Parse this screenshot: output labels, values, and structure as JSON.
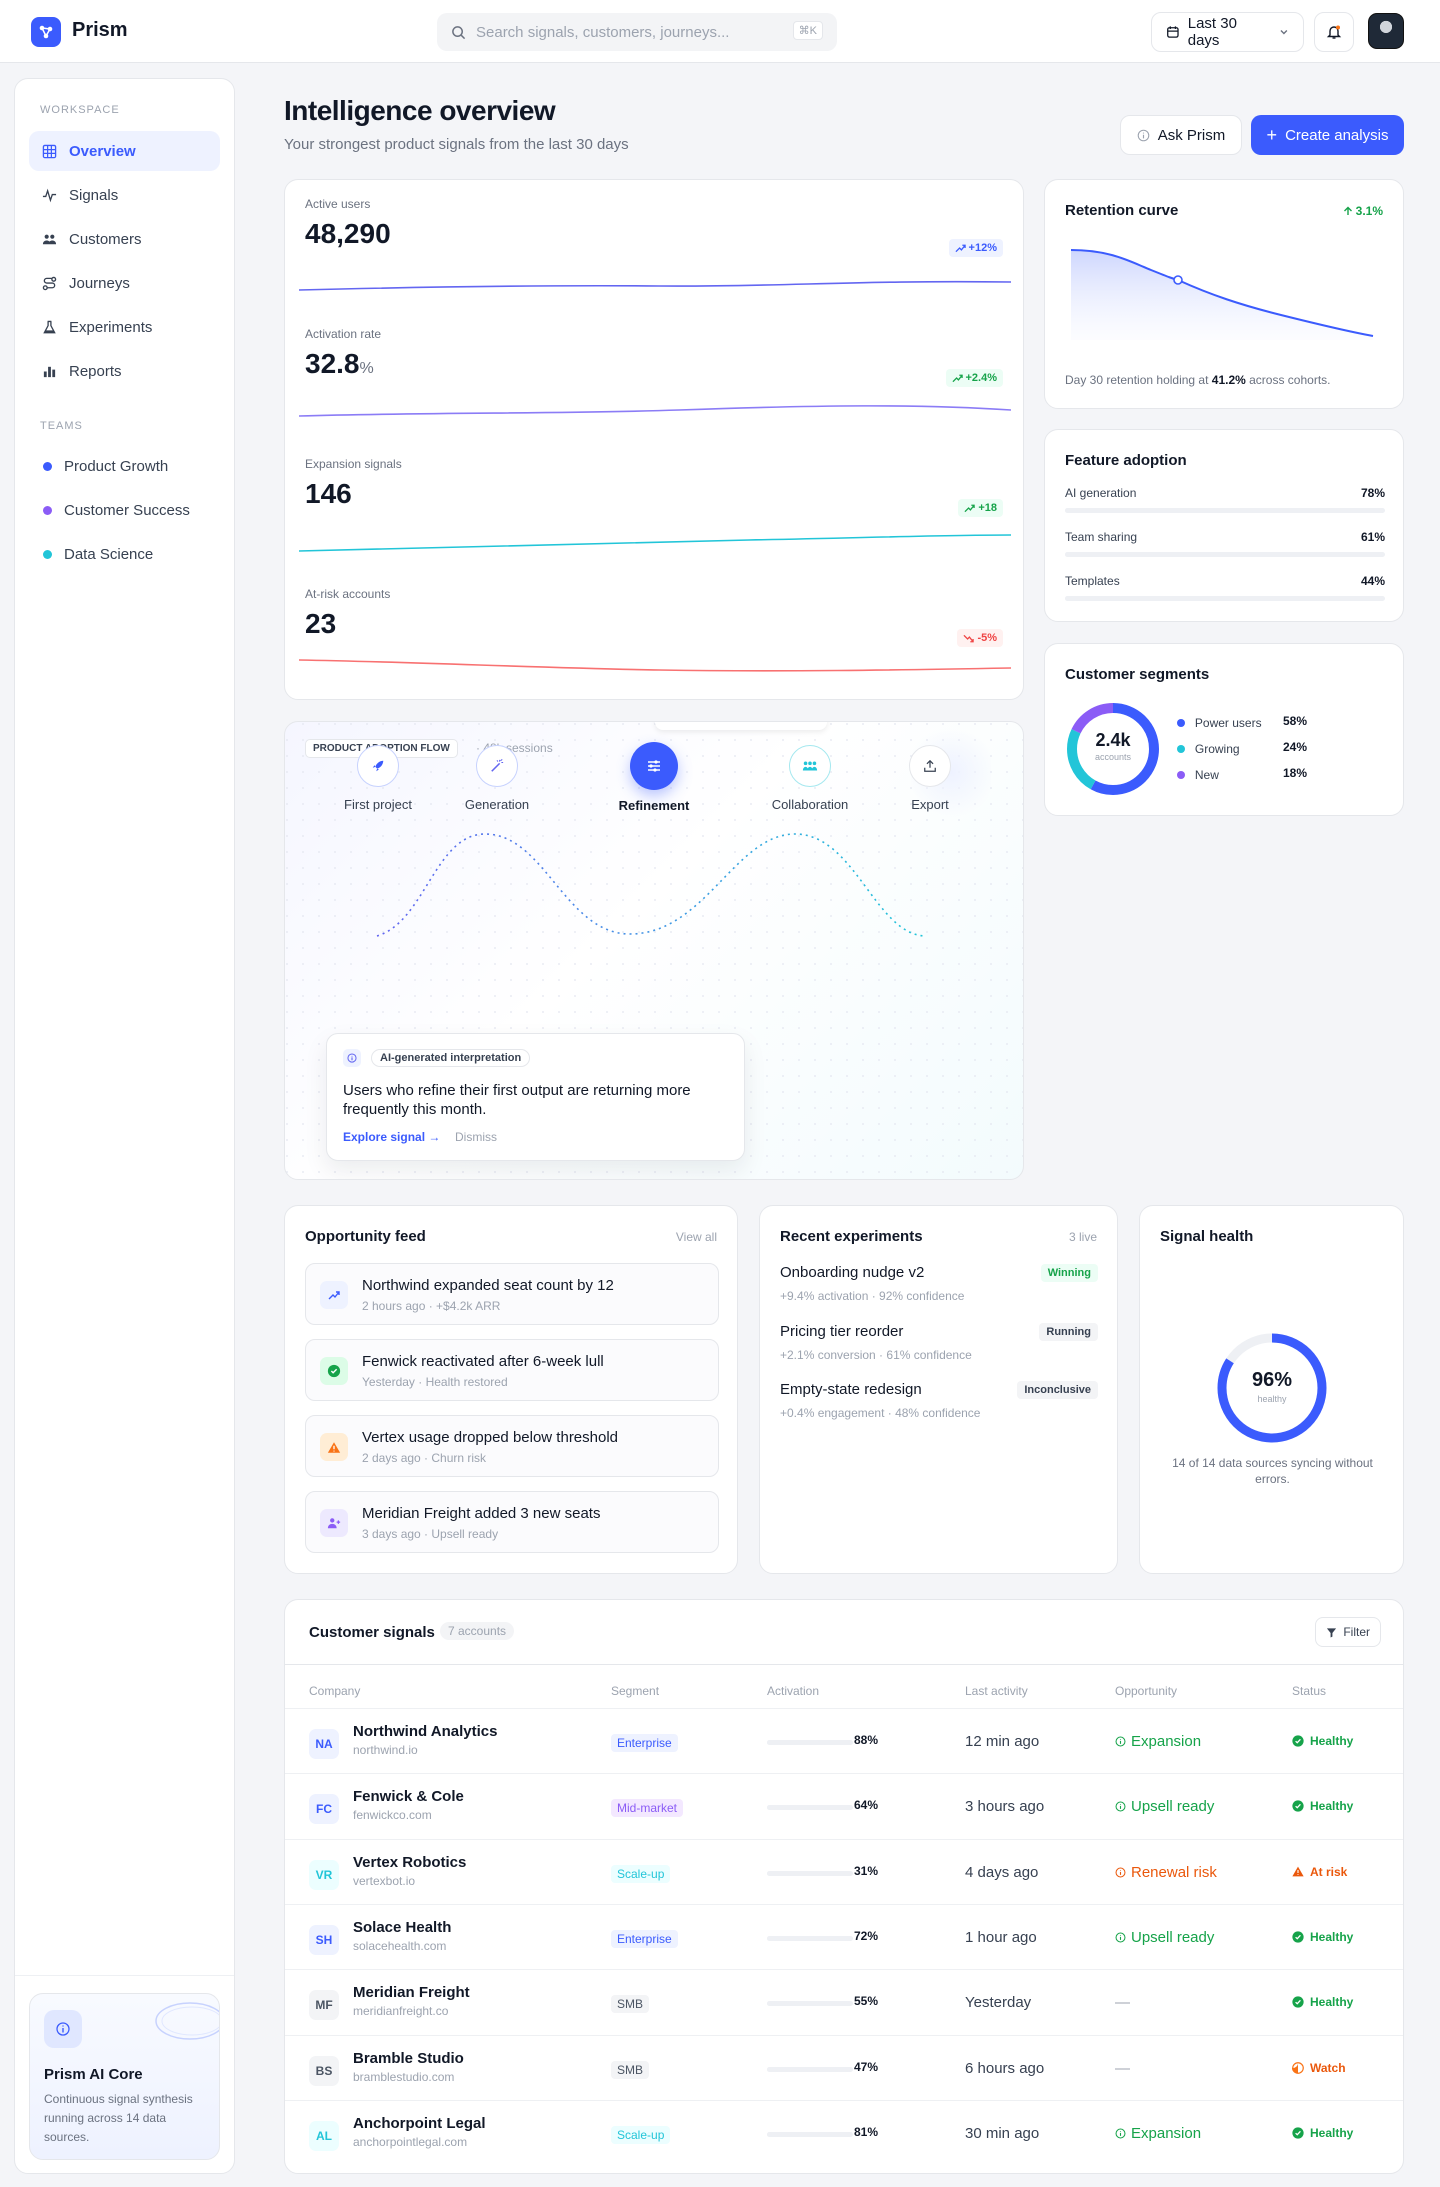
{
  "topbar": {
    "brand": "Prism",
    "search_placeholder": "Search signals, customers, journeys...",
    "search_shortcut": "⌘K",
    "date_range": "Last 30 days"
  },
  "sidebar": {
    "workspace_label": "WORKSPACE",
    "items": [
      {
        "label": "Overview"
      },
      {
        "label": "Signals"
      },
      {
        "label": "Customers"
      },
      {
        "label": "Journeys"
      },
      {
        "label": "Experiments"
      },
      {
        "label": "Reports"
      }
    ],
    "teams_label": "TEAMS",
    "teams": [
      {
        "label": "Product Growth",
        "color": "#3b5bfd"
      },
      {
        "label": "Customer Success",
        "color": "#8b5cf6"
      },
      {
        "label": "Data Science",
        "color": "#22c5d8"
      }
    ],
    "ai_core": {
      "title": "Prism AI Core",
      "desc": "Continuous signal synthesis running across 14 data sources."
    }
  },
  "header": {
    "title": "Intelligence overview",
    "subtitle": "Your strongest product signals from the last 30 days",
    "ask_label": "Ask Prism",
    "create_label": "Create analysis"
  },
  "metrics": [
    {
      "label": "Active users",
      "value": "48,290",
      "unit": "",
      "delta": "+12%",
      "tone": "up-blue"
    },
    {
      "label": "Activation rate",
      "value": "32.8",
      "unit": "%",
      "delta": "+2.4%",
      "tone": "up-green"
    },
    {
      "label": "Expansion signals",
      "value": "146",
      "unit": "",
      "delta": "+18",
      "tone": "up-green"
    },
    {
      "label": "At-risk accounts",
      "value": "23",
      "unit": "",
      "delta": "-5%",
      "tone": "down-red"
    }
  ],
  "retention": {
    "title": "Retention curve",
    "delta": "3.1%",
    "note_pre": "Day 30 retention holding at ",
    "note_value": "41.2%",
    "note_post": " across cohorts."
  },
  "feature_adoption": {
    "title": "Feature adoption",
    "rows": [
      {
        "label": "AI generation",
        "pct": "78%",
        "value": 0.78
      },
      {
        "label": "Team sharing",
        "pct": "61%",
        "value": 0.61
      },
      {
        "label": "Templates",
        "pct": "44%",
        "value": 0.44
      }
    ]
  },
  "segments": {
    "title": "Customer segments",
    "center_value": "2.4k",
    "center_label": "accounts",
    "rows": [
      {
        "label": "Power users",
        "pct": "58%",
        "value": 58,
        "color": "#3b5bfd"
      },
      {
        "label": "Growing",
        "pct": "24%",
        "value": 24,
        "color": "#22c5d8"
      },
      {
        "label": "New",
        "pct": "18%",
        "value": 18,
        "color": "#8b5cf6"
      }
    ]
  },
  "flow": {
    "badge": "PRODUCT ADOPTION FLOW",
    "sessions": "· 48k sessions",
    "steps": [
      {
        "label": "First project"
      },
      {
        "label": "Generation"
      },
      {
        "label": "Refinement"
      },
      {
        "label": "Collaboration"
      },
      {
        "label": "Export"
      }
    ],
    "insight": {
      "tag": "AI-generated interpretation",
      "text": "Users who refine their first output are returning more frequently this month.",
      "explore": "Explore signal →",
      "dismiss": "Dismiss"
    }
  },
  "opportunity_feed": {
    "title": "Opportunity feed",
    "view_all": "View all",
    "items": [
      {
        "title": "Northwind expanded seat count by 12",
        "meta": "2 hours ago · +$4.2k ARR"
      },
      {
        "title": "Fenwick reactivated after 6-week lull",
        "meta": "Yesterday · Health restored"
      },
      {
        "title": "Vertex usage dropped below threshold",
        "meta": "2 days ago · Churn risk"
      },
      {
        "title": "Meridian Freight added 3 new seats",
        "meta": "3 days ago · Upsell ready"
      }
    ]
  },
  "experiments": {
    "title": "Recent experiments",
    "count": "3 live",
    "items": [
      {
        "name": "Onboarding nudge v2",
        "meta": "+9.4% activation · 92% confidence",
        "badge": "Winning"
      },
      {
        "name": "Pricing tier reorder",
        "meta": "+2.1% conversion · 61% confidence",
        "badge": "Running"
      },
      {
        "name": "Empty-state redesign",
        "meta": "+0.4% engagement · 48% confidence",
        "badge": "Inconclusive"
      }
    ]
  },
  "signal_health": {
    "title": "Signal health",
    "value": "96%",
    "label": "healthy",
    "fraction": 0.96,
    "note": "14 of 14 data sources syncing without errors."
  },
  "table": {
    "title": "Customer signals",
    "count": "7 accounts",
    "filter": "Filter",
    "columns": [
      "Company",
      "Segment",
      "Activation",
      "Last activity",
      "Opportunity",
      "Status"
    ],
    "rows": [
      {
        "initials": "NA",
        "name": "Northwind Analytics",
        "domain": "northwind.io",
        "segment": "Enterprise",
        "activation": "88%",
        "act": 0.88,
        "last": "12 min ago",
        "opportunity": "Expansion",
        "status": "Healthy"
      },
      {
        "initials": "FC",
        "name": "Fenwick & Cole",
        "domain": "fenwickco.com",
        "segment": "Mid-market",
        "activation": "64%",
        "act": 0.64,
        "last": "3 hours ago",
        "opportunity": "Upsell ready",
        "status": "Healthy"
      },
      {
        "initials": "VR",
        "name": "Vertex Robotics",
        "domain": "vertexbot.io",
        "segment": "Scale-up",
        "activation": "31%",
        "act": 0.31,
        "last": "4 days ago",
        "opportunity": "Renewal risk",
        "status": "At risk"
      },
      {
        "initials": "SH",
        "name": "Solace Health",
        "domain": "solacehealth.com",
        "segment": "Enterprise",
        "activation": "72%",
        "act": 0.72,
        "last": "1 hour ago",
        "opportunity": "Upsell ready",
        "status": "Healthy"
      },
      {
        "initials": "MF",
        "name": "Meridian Freight",
        "domain": "meridianfreight.co",
        "segment": "SMB",
        "activation": "55%",
        "act": 0.55,
        "last": "Yesterday",
        "opportunity": "—",
        "status": "Healthy"
      },
      {
        "initials": "BS",
        "name": "Bramble Studio",
        "domain": "bramblestudio.com",
        "segment": "SMB",
        "activation": "47%",
        "act": 0.47,
        "last": "6 hours ago",
        "opportunity": "—",
        "status": "Watch"
      },
      {
        "initials": "AL",
        "name": "Anchorpoint Legal",
        "domain": "anchorpointlegal.com",
        "segment": "Scale-up",
        "activation": "81%",
        "act": 0.81,
        "last": "30 min ago",
        "opportunity": "Expansion",
        "status": "Healthy"
      }
    ]
  },
  "colors": {
    "accent": "#3b5bfd",
    "green": "#16a34a",
    "orange": "#ea580c",
    "cyan": "#22c5d8",
    "purple": "#8b5cf6",
    "red": "#ef4444"
  }
}
